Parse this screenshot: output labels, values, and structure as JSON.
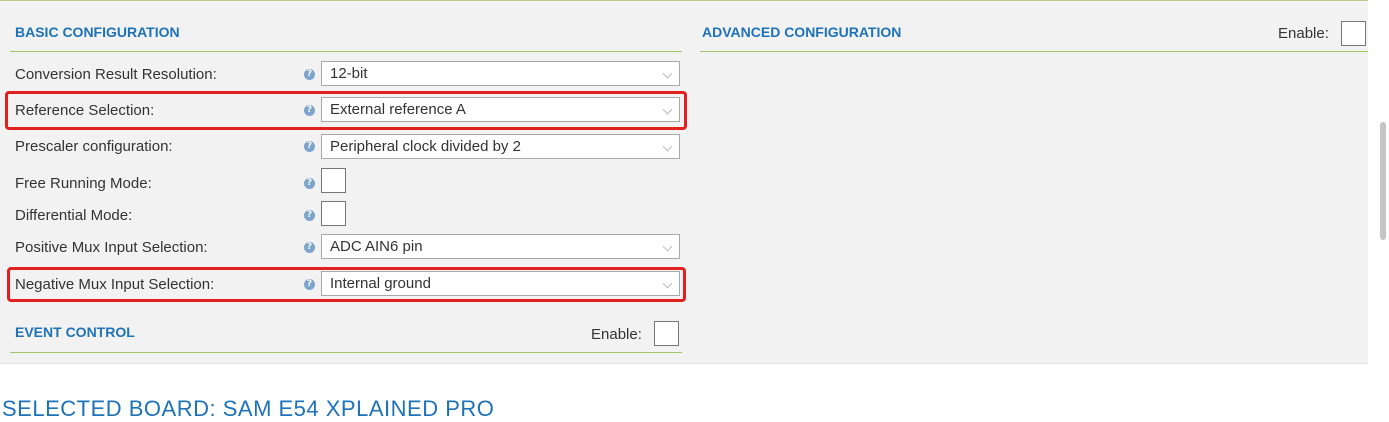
{
  "basic": {
    "title": "BASIC CONFIGURATION",
    "rows": [
      {
        "label": "Conversion Result Resolution:",
        "value": "12-bit"
      },
      {
        "label": "Reference Selection:",
        "value": "External reference A"
      },
      {
        "label": "Prescaler configuration:",
        "value": "Peripheral clock divided by 2"
      },
      {
        "label": "Free Running Mode:",
        "checked": false
      },
      {
        "label": "Differential Mode:",
        "checked": false
      },
      {
        "label": "Positive Mux Input Selection:",
        "value": "ADC AIN6 pin"
      },
      {
        "label": "Negative Mux Input Selection:",
        "value": "Internal ground"
      }
    ],
    "help_glyph": "?"
  },
  "event_control": {
    "title": "EVENT CONTROL",
    "enable_label": "Enable:",
    "checked": false
  },
  "advanced": {
    "title": "ADVANCED CONFIGURATION",
    "enable_label": "Enable:",
    "checked": false
  },
  "board": {
    "title": "SELECTED BOARD: SAM E54 XPLAINED PRO"
  },
  "colors": {
    "accent": "#1d72b8",
    "highlight": "#e32020",
    "rule": "#a3c46c"
  }
}
